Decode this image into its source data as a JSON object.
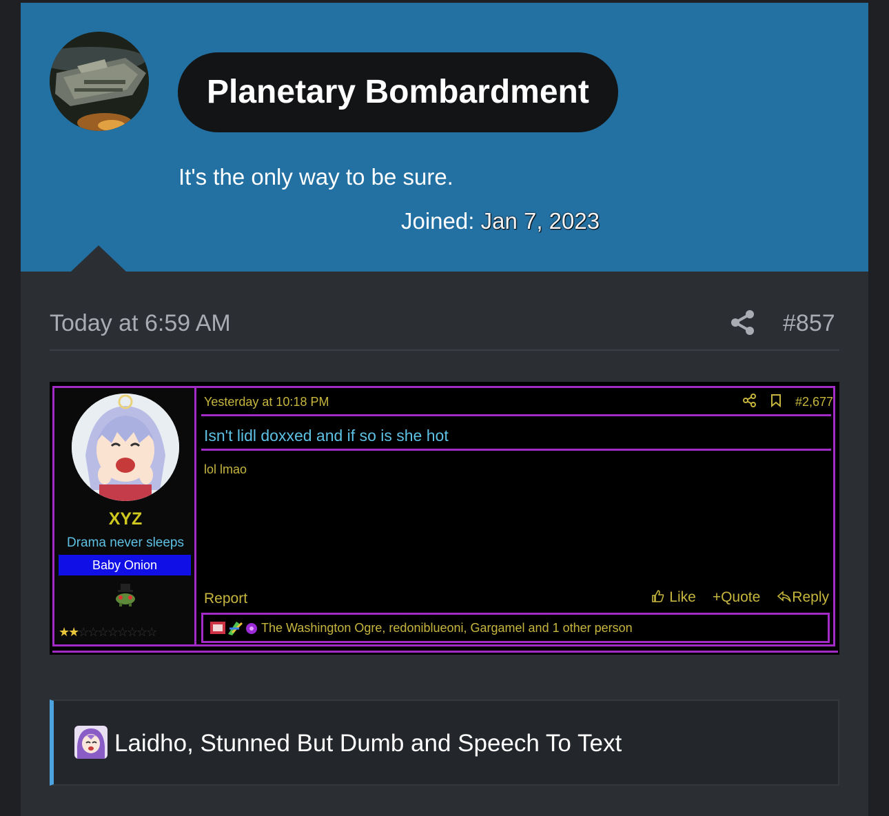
{
  "user": {
    "name": "Planetary Bombardment",
    "title": "It's the only way to be sure.",
    "joined_label": "Joined:",
    "joined_date": "Jan 7, 2023"
  },
  "post": {
    "time": "Today at 6:59 AM",
    "number": "#857",
    "share_icon": "share-icon"
  },
  "embed": {
    "user_name": "XYZ",
    "user_title": "Drama never sleeps",
    "user_banner": "Baby Onion",
    "time": "Yesterday at 10:18 PM",
    "number": "#2,677",
    "thread_title": "Isn't lidl doxxed and if so is she hot",
    "body": "lol lmao",
    "report": "Report",
    "like": "Like",
    "quote": "Quote",
    "reply": "Reply",
    "reactions": "The Washington Ogre, redoniblueoni, Gargamel and 1 other person",
    "stars_filled": 2,
    "stars_total": 10,
    "colors": {
      "accent": "#a22bc8",
      "gold": "#c7b63e",
      "cyan": "#5ec1e4",
      "banner": "#1010e6"
    }
  },
  "reactions_summary": {
    "text": "Laidho, Stunned But Dumb and Speech To Text"
  },
  "colors": {
    "header_bg": "#2370a2",
    "page_bg": "#2b2e33",
    "pill_bg": "#131416",
    "reaction_accent": "#4da3e0"
  }
}
